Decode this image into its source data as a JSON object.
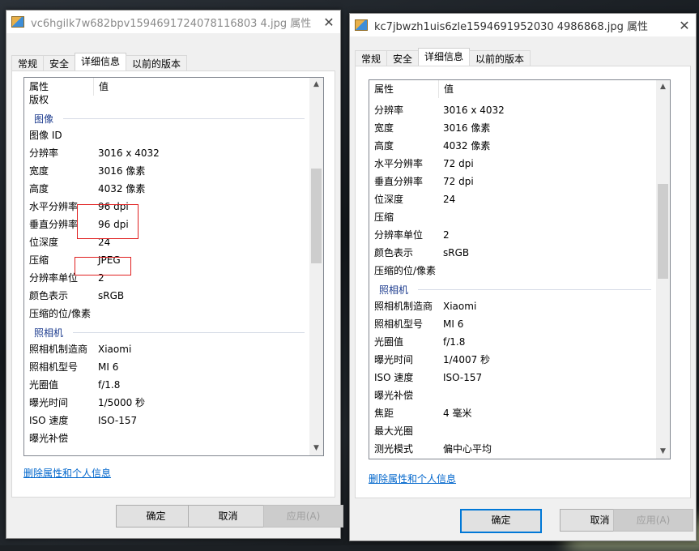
{
  "left_window": {
    "title": "vc6hgilk7w682bpv1594691724078116803 4.jpg 属性",
    "tabs": [
      "常规",
      "安全",
      "详细信息",
      "以前的版本"
    ],
    "active_tab": 2,
    "columns": [
      "属性",
      "值"
    ],
    "rows": [
      {
        "type": "row",
        "k": "版权",
        "v": ""
      },
      {
        "type": "section",
        "k": "图像"
      },
      {
        "type": "row",
        "k": "图像 ID",
        "v": ""
      },
      {
        "type": "row",
        "k": "分辨率",
        "v": "3016 x 4032"
      },
      {
        "type": "row",
        "k": "宽度",
        "v": "3016 像素"
      },
      {
        "type": "row",
        "k": "高度",
        "v": "4032 像素"
      },
      {
        "type": "row",
        "k": "水平分辨率",
        "v": "96 dpi"
      },
      {
        "type": "row",
        "k": "垂直分辨率",
        "v": "96 dpi"
      },
      {
        "type": "row",
        "k": "位深度",
        "v": "24"
      },
      {
        "type": "row",
        "k": "压缩",
        "v": "JPEG"
      },
      {
        "type": "row",
        "k": "分辨率单位",
        "v": "2"
      },
      {
        "type": "row",
        "k": "颜色表示",
        "v": "sRGB"
      },
      {
        "type": "row",
        "k": "压缩的位/像素",
        "v": ""
      },
      {
        "type": "section",
        "k": "照相机"
      },
      {
        "type": "row",
        "k": "照相机制造商",
        "v": "Xiaomi"
      },
      {
        "type": "row",
        "k": "照相机型号",
        "v": "MI 6"
      },
      {
        "type": "row",
        "k": "光圈值",
        "v": "f/1.8"
      },
      {
        "type": "row",
        "k": "曝光时间",
        "v": "1/5000 秒"
      },
      {
        "type": "row",
        "k": "ISO 速度",
        "v": "ISO-157"
      },
      {
        "type": "row",
        "k": "曝光补偿",
        "v": ""
      }
    ],
    "scroll_position": 0.3,
    "remove_link": "删除属性和个人信息",
    "buttons": {
      "ok": "确定",
      "cancel": "取消",
      "apply": "应用(A)"
    }
  },
  "right_window": {
    "title": "kc7jbwzh1uis6zle1594691952030 4986868.jpg 属性",
    "tabs": [
      "常规",
      "安全",
      "详细信息",
      "以前的版本"
    ],
    "active_tab": 2,
    "columns": [
      "属性",
      "值"
    ],
    "rows": [
      {
        "type": "row",
        "k": "分辨率",
        "v": "3016 x 4032"
      },
      {
        "type": "row",
        "k": "宽度",
        "v": "3016 像素"
      },
      {
        "type": "row",
        "k": "高度",
        "v": "4032 像素"
      },
      {
        "type": "row",
        "k": "水平分辨率",
        "v": "72 dpi"
      },
      {
        "type": "row",
        "k": "垂直分辨率",
        "v": "72 dpi"
      },
      {
        "type": "row",
        "k": "位深度",
        "v": "24"
      },
      {
        "type": "row",
        "k": "压缩",
        "v": ""
      },
      {
        "type": "row",
        "k": "分辨率单位",
        "v": "2"
      },
      {
        "type": "row",
        "k": "颜色表示",
        "v": "sRGB"
      },
      {
        "type": "row",
        "k": "压缩的位/像素",
        "v": ""
      },
      {
        "type": "section",
        "k": "照相机"
      },
      {
        "type": "row",
        "k": "照相机制造商",
        "v": "Xiaomi"
      },
      {
        "type": "row",
        "k": "照相机型号",
        "v": "MI 6"
      },
      {
        "type": "row",
        "k": "光圈值",
        "v": "f/1.8"
      },
      {
        "type": "row",
        "k": "曝光时间",
        "v": "1/4007 秒"
      },
      {
        "type": "row",
        "k": "ISO 速度",
        "v": "ISO-157"
      },
      {
        "type": "row",
        "k": "曝光补偿",
        "v": ""
      },
      {
        "type": "row",
        "k": "焦距",
        "v": "4 毫米"
      },
      {
        "type": "row",
        "k": "最大光圈",
        "v": ""
      },
      {
        "type": "row",
        "k": "测光模式",
        "v": "偏中心平均"
      }
    ],
    "scroll_position": 0.35,
    "remove_link": "删除属性和个人信息",
    "buttons": {
      "ok": "确定",
      "cancel": "取消",
      "apply": "应用(A)"
    }
  },
  "colors": {
    "accent": "#0078d7",
    "link": "#0066cc",
    "section_text": "#1e3d8f",
    "highlight_box": "#e02020"
  }
}
